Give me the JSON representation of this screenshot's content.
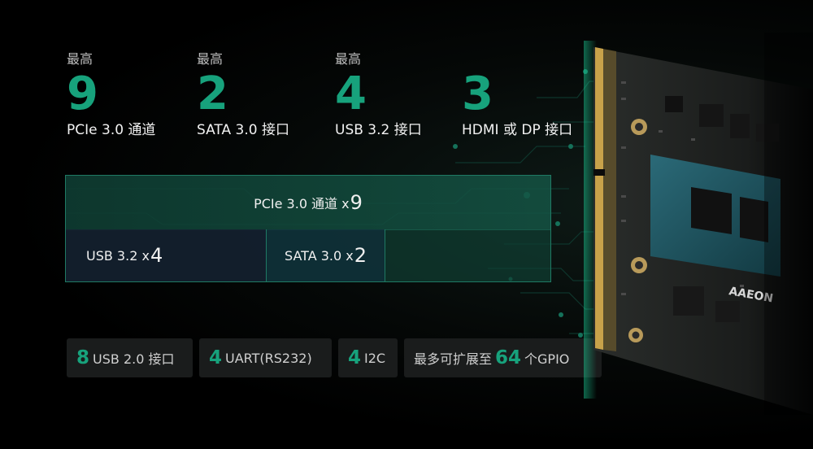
{
  "specs": [
    {
      "prefix": "最高",
      "value": "9",
      "label": "PCIe 3.0 通道"
    },
    {
      "prefix": "最高",
      "value": "2",
      "label": "SATA 3.0 接口"
    },
    {
      "prefix": "最高",
      "value": "4",
      "label": "USB 3.2 接口"
    },
    {
      "prefix": "",
      "value": "3",
      "label": "HDMI 或 DP 接口"
    }
  ],
  "lanes": {
    "pcie": {
      "text": "PCIe 3.0 通道 x",
      "count": "9"
    },
    "usb": {
      "text": "USB 3.2 x",
      "count": "4"
    },
    "sata": {
      "text": "SATA 3.0 x",
      "count": "2"
    }
  },
  "chips": [
    {
      "value": "8",
      "text": "USB 2.0 接口"
    },
    {
      "value": "4",
      "text": "UART(RS232)"
    },
    {
      "value": "4",
      "text": "I2C"
    },
    {
      "prefix": "最多可扩展至",
      "value": "64",
      "suffix": "个GPIO"
    }
  ],
  "board": {
    "logo_text": "AAEON"
  },
  "colors": {
    "accent_green": "#17a27c",
    "gold_edge": "#c8a24a",
    "pcb": "#1b1d1c"
  }
}
